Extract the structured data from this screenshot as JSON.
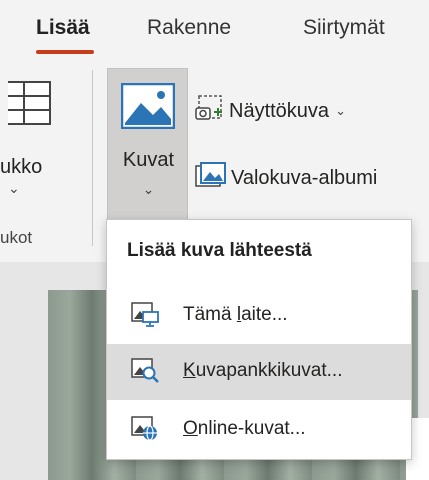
{
  "tabs": {
    "lisaa": "Lisää",
    "rakenne": "Rakenne",
    "siirtymat": "Siirtymät"
  },
  "ribbon": {
    "table_label": "ukko",
    "group_label": "ukot",
    "kuvat_label": "Kuvat",
    "nayttokuva_label": "Näyttökuva",
    "valokuva_label": "Valokuva-albumi"
  },
  "menu": {
    "header": "Lisää kuva lähteestä",
    "items": [
      {
        "prefix": "Tämä ",
        "accel": "l",
        "rest": "aite..."
      },
      {
        "prefix": "",
        "accel": "K",
        "rest": "uvapankkikuvat..."
      },
      {
        "prefix": "",
        "accel": "O",
        "rest": "nline-kuvat..."
      }
    ]
  },
  "icons": {
    "table": "table-icon",
    "pictures": "pictures-icon",
    "screenshot": "screenshot-icon",
    "photo_album": "photo-album-icon",
    "this_device": "this-device-icon",
    "stock_images": "stock-images-icon",
    "online_pictures": "online-pictures-icon"
  },
  "colors": {
    "accent_tab": "#c43e1c",
    "icon_blue": "#2b74b5",
    "highlight": "#dcdcdc"
  }
}
